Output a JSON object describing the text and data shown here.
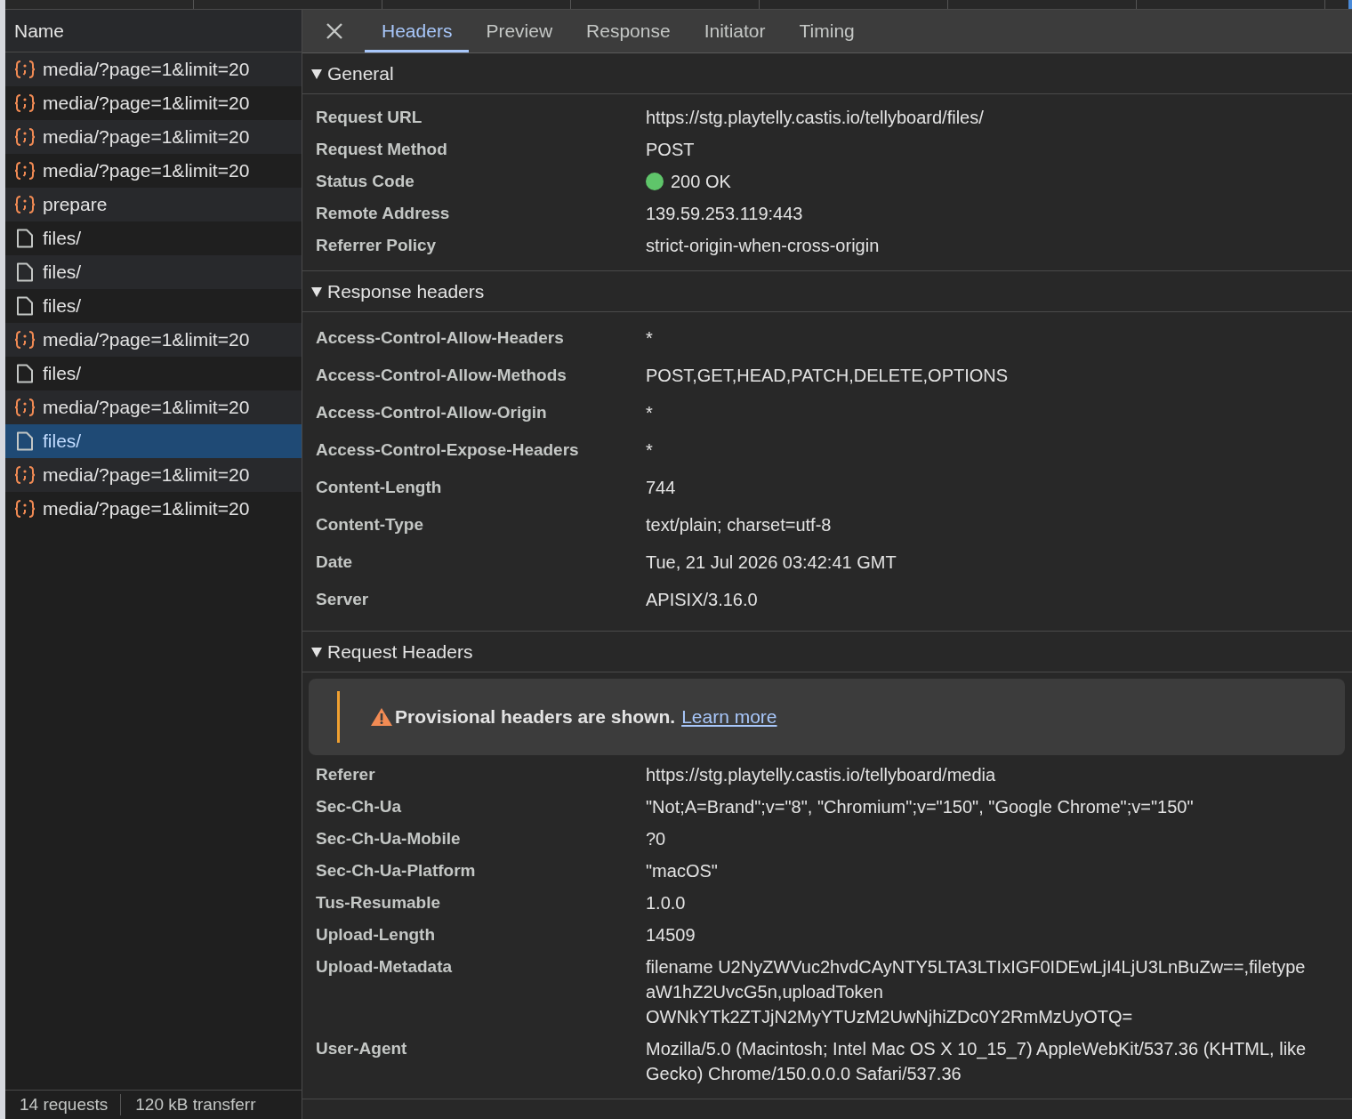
{
  "request_list": {
    "column": "Name",
    "rows": [
      {
        "kind": "fetch",
        "name": "media/?page=1&limit=20",
        "selected": false
      },
      {
        "kind": "fetch",
        "name": "media/?page=1&limit=20",
        "selected": false
      },
      {
        "kind": "fetch",
        "name": "media/?page=1&limit=20",
        "selected": false
      },
      {
        "kind": "fetch",
        "name": "media/?page=1&limit=20",
        "selected": false
      },
      {
        "kind": "fetch",
        "name": "prepare",
        "selected": false
      },
      {
        "kind": "document",
        "name": "files/",
        "selected": false
      },
      {
        "kind": "document",
        "name": "files/",
        "selected": false
      },
      {
        "kind": "document",
        "name": "files/",
        "selected": false
      },
      {
        "kind": "fetch",
        "name": "media/?page=1&limit=20",
        "selected": false
      },
      {
        "kind": "document",
        "name": "files/",
        "selected": false
      },
      {
        "kind": "fetch",
        "name": "media/?page=1&limit=20",
        "selected": false
      },
      {
        "kind": "document",
        "name": "files/",
        "selected": true
      },
      {
        "kind": "fetch",
        "name": "media/?page=1&limit=20",
        "selected": false
      },
      {
        "kind": "fetch",
        "name": "media/?page=1&limit=20",
        "selected": false
      }
    ],
    "status_bar": [
      "14 requests",
      "120 kB transferr"
    ]
  },
  "tabs": [
    {
      "label": "Headers",
      "selected": true
    },
    {
      "label": "Preview",
      "selected": false
    },
    {
      "label": "Response",
      "selected": false
    },
    {
      "label": "Initiator",
      "selected": false
    },
    {
      "label": "Timing",
      "selected": false
    }
  ],
  "sections": [
    {
      "kind": "general",
      "title": "General",
      "expanded": true,
      "rows": [
        {
          "name": "Request URL",
          "value": "https://stg.playtelly.castis.io/tellyboard/files/"
        },
        {
          "name": "Request Method",
          "value": "POST"
        },
        {
          "name": "Status Code",
          "value": "200 OK",
          "color": "#5fc56a"
        },
        {
          "name": "Remote Address",
          "value": "139.59.253.119:443"
        },
        {
          "name": "Referrer Policy",
          "value": "strict-origin-when-cross-origin"
        }
      ]
    },
    {
      "kind": "response",
      "title": "Response headers",
      "expanded": true,
      "rows": [
        {
          "name": "Access-Control-Allow-Headers",
          "value": "*"
        },
        {
          "name": "Access-Control-Allow-Methods",
          "value": "POST,GET,HEAD,PATCH,DELETE,OPTIONS"
        },
        {
          "name": "Access-Control-Allow-Origin",
          "value": "*"
        },
        {
          "name": "Access-Control-Expose-Headers",
          "value": "*"
        },
        {
          "name": "Content-Length",
          "value": "744"
        },
        {
          "name": "Content-Type",
          "value": "text/plain; charset=utf-8"
        },
        {
          "name": "Date",
          "value": "Tue, 21 Jul 2026 03:42:41 GMT"
        },
        {
          "name": "Server",
          "value": "APISIX/3.16.0"
        }
      ]
    },
    {
      "kind": "request",
      "title": "Request Headers",
      "expanded": true,
      "notice": {
        "text": "Provisional headers are shown.",
        "link": "Learn more"
      },
      "rows": [
        {
          "name": "Referer",
          "value": "https://stg.playtelly.castis.io/tellyboard/media"
        },
        {
          "name": "Sec-Ch-Ua",
          "value": "\"Not;A=Brand\";v=\"8\", \"Chromium\";v=\"150\", \"Google Chrome\";v=\"150\""
        },
        {
          "name": "Sec-Ch-Ua-Mobile",
          "value": "?0"
        },
        {
          "name": "Sec-Ch-Ua-Platform",
          "value": "\"macOS\""
        },
        {
          "name": "Tus-Resumable",
          "value": "1.0.0"
        },
        {
          "name": "Upload-Length",
          "value": "14509"
        },
        {
          "name": "Upload-Metadata",
          "value": "filename U2NyZWVuc2hvdCAyNTY5LTA3LTIxIGF0IDEwLjI4LjU3LnBuZw==,filetype aW1hZ2UvcG5n,uploadToken OWNkYTk2ZTJjN2MyYTUzM2UwNjhiZDc0Y2RmMzUyOTQ="
        },
        {
          "name": "User-Agent",
          "value": "Mozilla/5.0 (Macintosh; Intel Mac OS X 10_15_7) AppleWebKit/537.36 (KHTML, like Gecko) Chrome/150.0.0.0 Safari/537.36"
        }
      ]
    }
  ]
}
